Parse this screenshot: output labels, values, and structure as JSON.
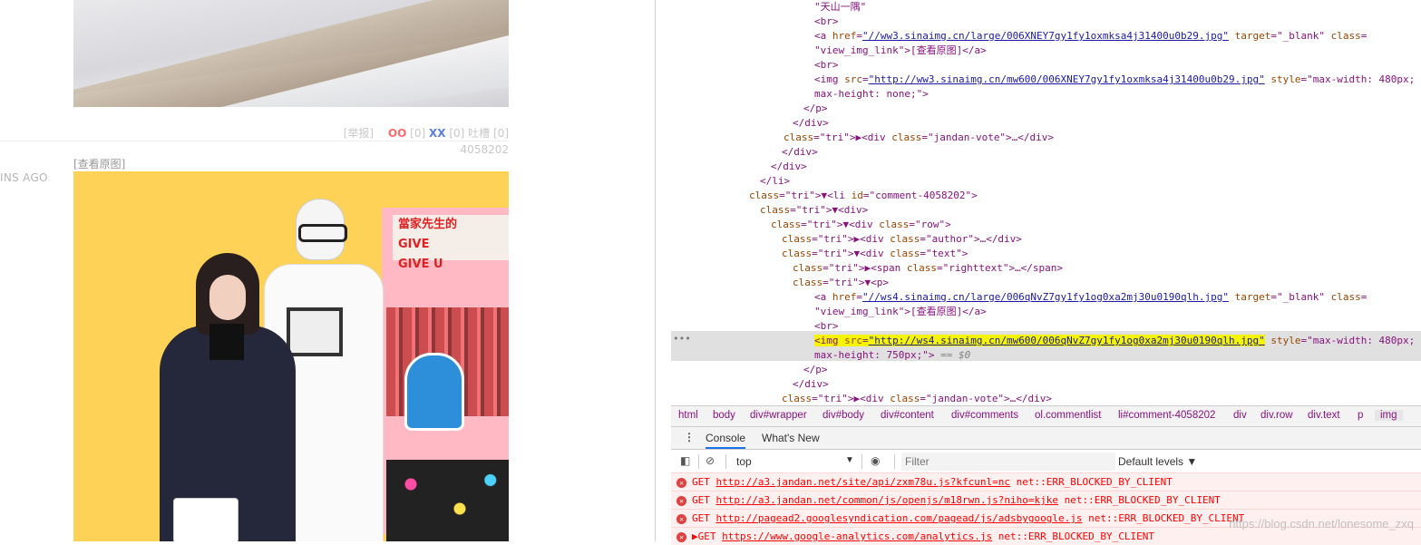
{
  "page": {
    "meta_report": "[举报]",
    "meta_oo": "OO",
    "meta_oo_count": "[0]",
    "meta_xx": "XX",
    "meta_xx_count": "[0]",
    "meta_tucao": "吐槽",
    "meta_tucao_count": "[0]",
    "post_id": "4058202",
    "time_ago": "INS AGO",
    "view_original": "[查看原图]",
    "poster_sign": "當家先生的\nGIVE\nGIVE U"
  },
  "elements": {
    "lines": [
      {
        "t": "\"天山一隅\""
      },
      {
        "t": "<br>"
      },
      {
        "t": "<a href=\"//ww3.sinaimg.cn/large/006XNEY7gy1fy1oxmksa4j31400u0b29.jpg\" target=\"_blank\" class="
      },
      {
        "t": "\"view_img_link\">[查看原图]</a>"
      },
      {
        "t": "<br>"
      },
      {
        "t": "<img src=\"http://ww3.sinaimg.cn/mw600/006XNEY7gy1fy1oxmksa4j31400u0b29.jpg\" style=\"max-width: 480px;"
      },
      {
        "t": "max-height: none;\">"
      },
      {
        "t": "</p>"
      },
      {
        "t": "</div>"
      },
      {
        "t": "▶<div class=\"jandan-vote\">…</div>"
      },
      {
        "t": "</div>"
      },
      {
        "t": "</div>"
      },
      {
        "t": "</li>"
      },
      {
        "t": "▼<li id=\"comment-4058202\">"
      },
      {
        "t": "▼<div>"
      },
      {
        "t": "▼<div class=\"row\">"
      },
      {
        "t": "▶<div class=\"author\">…</div>"
      },
      {
        "t": "▼<div class=\"text\">"
      },
      {
        "t": "▶<span class=\"righttext\">…</span>"
      },
      {
        "t": "▼<p>"
      },
      {
        "t": "<a href=\"//ws4.sinaimg.cn/large/006qNvZ7gy1fy1og0xa2mj30u0190qlh.jpg\" target=\"_blank\" class="
      },
      {
        "t": "\"view_img_link\">[查看原图]</a>"
      },
      {
        "t": "<br>"
      },
      {
        "t": "<img src=\"http://ws4.sinaimg.cn/mw600/006qNvZ7gy1fy1og0xa2mj30u0190qlh.jpg\" style=\"max-width: 480px;"
      },
      {
        "t": "max-height: 750px;\"> == $0"
      },
      {
        "t": "</p>"
      },
      {
        "t": "</div>"
      },
      {
        "t": "▶<div class=\"jandan-vote\">…</div>"
      },
      {
        "t": "</div>"
      }
    ]
  },
  "breadcrumbs": [
    "html",
    "body",
    "div#wrapper",
    "div#body",
    "div#content",
    "div#comments",
    "ol.commentlist",
    "li#comment-4058202",
    "div",
    "div.row",
    "div.text",
    "p",
    "img"
  ],
  "drawer": {
    "tab_console": "Console",
    "tab_whats_new": "What's New"
  },
  "console": {
    "context": "top",
    "filter_placeholder": "Filter",
    "levels": "Default levels ▼",
    "errors": [
      {
        "method": "GET",
        "url": "http://a3.jandan.net/site/api/zxm78u.js?kfcunl=nc",
        "msg": "net::ERR_BLOCKED_BY_CLIENT"
      },
      {
        "method": "GET",
        "url": "http://a3.jandan.net/common/js/openjs/m18rwn.js?niho=kjke",
        "msg": "net::ERR_BLOCKED_BY_CLIENT"
      },
      {
        "method": "GET",
        "url": "http://pagead2.googlesyndication.com/pagead/js/adsbygoogle.js",
        "msg": "net::ERR_BLOCKED_BY_CLIENT"
      },
      {
        "method": "▶GET",
        "url": "https://www.google-analytics.com/analytics.js",
        "msg": "net::ERR_BLOCKED_BY_CLIENT"
      }
    ]
  },
  "watermark": "https://blog.csdn.net/lonesome_zxq"
}
